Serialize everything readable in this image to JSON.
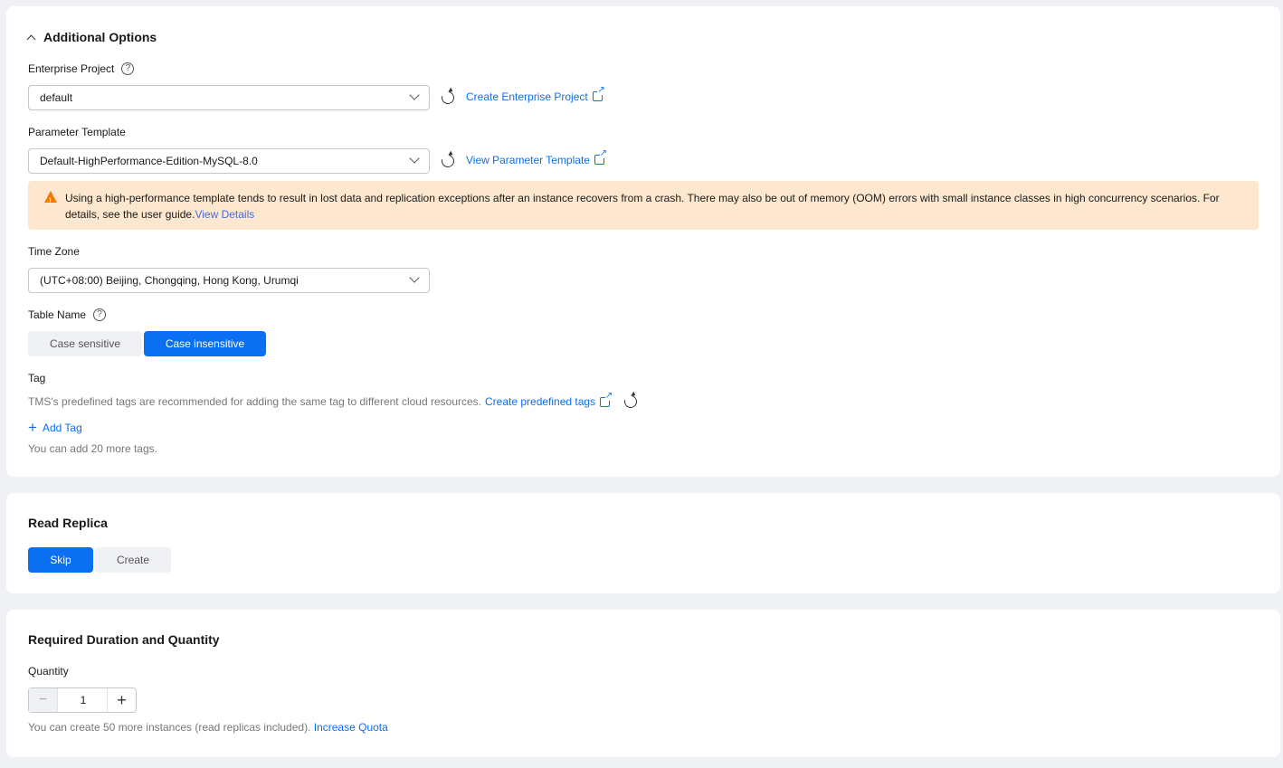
{
  "additional_options": {
    "title": "Additional Options",
    "enterprise_project": {
      "label": "Enterprise Project",
      "help": "?",
      "value": "default",
      "link": "Create Enterprise Project"
    },
    "parameter_template": {
      "label": "Parameter Template",
      "value": "Default-HighPerformance-Edition-MySQL-8.0",
      "link": "View Parameter Template"
    },
    "warning": {
      "text": "Using a high-performance template tends to result in lost data and replication exceptions after an instance recovers from a crash. There may also be out of memory (OOM) errors with small instance classes in high concurrency scenarios. For details, see the user guide.",
      "link": "View Details"
    },
    "time_zone": {
      "label": "Time Zone",
      "value": "(UTC+08:00) Beijing, Chongqing, Hong Kong, Urumqi"
    },
    "table_name": {
      "label": "Table Name",
      "help": "?",
      "options": [
        "Case sensitive",
        "Case insensitive"
      ],
      "selected": "Case insensitive"
    },
    "tag": {
      "label": "Tag",
      "hint": "TMS's predefined tags are recommended for adding the same tag to different cloud resources.",
      "link": "Create predefined tags",
      "add_label": "Add Tag",
      "remaining": "You can add 20 more tags."
    }
  },
  "read_replica": {
    "title": "Read Replica",
    "options": [
      "Skip",
      "Create"
    ],
    "selected": "Skip"
  },
  "duration_quantity": {
    "title": "Required Duration and Quantity",
    "quantity_label": "Quantity",
    "quantity_value": "1",
    "minus": "−",
    "plus": "+",
    "quota_text": "You can create 50 more instances (read replicas included).",
    "quota_link": "Increase Quota"
  },
  "colors": {
    "accent": "#0b6ff2",
    "warning_bg": "#fde8cf",
    "warning_icon": "#f57b00"
  }
}
